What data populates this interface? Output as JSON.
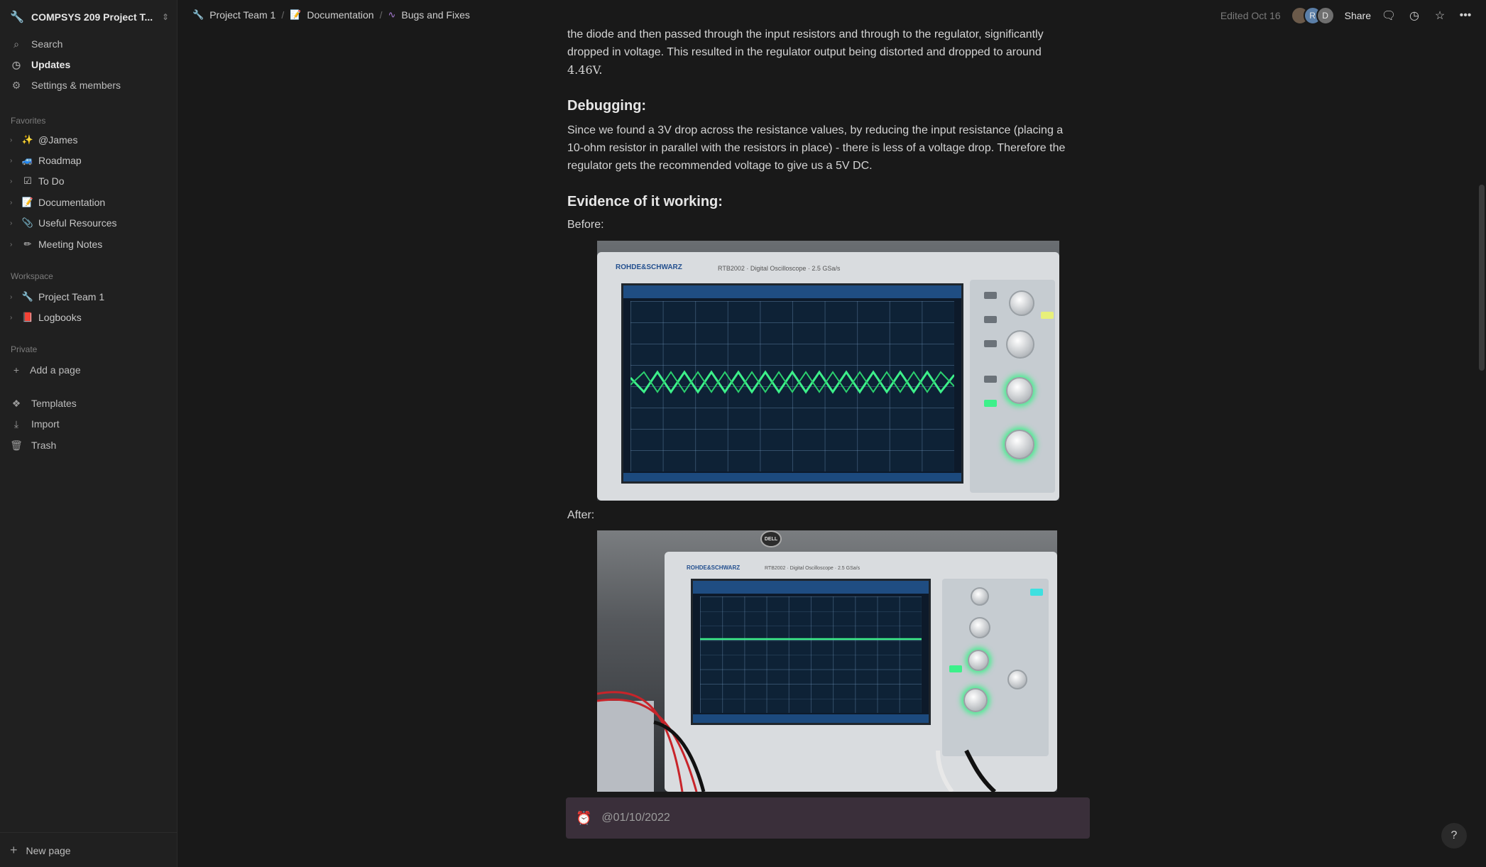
{
  "workspace": {
    "name": "COMPSYS 209 Project T..."
  },
  "sidebar": {
    "top_items": [
      {
        "label": "Search",
        "icon": "search-icon"
      },
      {
        "label": "Updates",
        "icon": "clock-icon"
      },
      {
        "label": "Settings & members",
        "icon": "gear-icon"
      }
    ],
    "favorites_label": "Favorites",
    "favorites": [
      {
        "label": "@James",
        "icon": "sparkles-icon"
      },
      {
        "label": "Roadmap",
        "icon": "car-icon"
      },
      {
        "label": "To Do",
        "icon": "checkbox-icon"
      },
      {
        "label": "Documentation",
        "icon": "memo-icon"
      },
      {
        "label": "Useful Resources",
        "icon": "paperclip-icon"
      },
      {
        "label": "Meeting Notes",
        "icon": "pencil-icon"
      }
    ],
    "workspace_label": "Workspace",
    "workspace_items": [
      {
        "label": "Project Team 1",
        "icon": "wrench-icon"
      },
      {
        "label": "Logbooks",
        "icon": "book-icon"
      }
    ],
    "private_label": "Private",
    "add_page": "Add a page",
    "bottom_items": [
      {
        "label": "Templates",
        "icon": "shapes-icon"
      },
      {
        "label": "Import",
        "icon": "download-icon"
      },
      {
        "label": "Trash",
        "icon": "trash-icon"
      }
    ],
    "new_page": "New page"
  },
  "breadcrumb": [
    {
      "label": "Project Team 1"
    },
    {
      "label": "Documentation"
    },
    {
      "label": "Bugs and Fixes"
    }
  ],
  "topbar": {
    "edited": "Edited Oct 16",
    "avatars": [
      "",
      "R",
      "D"
    ],
    "share": "Share"
  },
  "content": {
    "intro_line1": "the diode and then passed through the input resistors and through to the regulator, significantly",
    "intro_line2": "dropped in voltage.  This resulted in the regulator output being distorted and dropped to around",
    "intro_line3": "4.46V.",
    "debug_heading": "Debugging:",
    "debug_line1": "Since we found a 3V drop across the resistance values, by reducing the input resistance (placing a",
    "debug_line2": "10-ohm resistor in parallel with the resistors in place) - there is less of a voltage drop. Therefore the",
    "debug_line3": "regulator gets the recommended voltage to give us a 5V DC.",
    "evidence_heading": "Evidence of it working:",
    "before_label": "Before:",
    "after_label": "After:",
    "scope_brand": "ROHDE&SCHWARZ",
    "scope_model": "RTB2002 · Digital Oscilloscope · 2.5 GSa/s",
    "dell": "DELL",
    "reminder_date": "@01/10/2022"
  },
  "help": "?",
  "colors": {
    "bg": "#191919",
    "sidebar": "#202020",
    "callout": "#3a2f3a",
    "trace": "#3df08a"
  }
}
